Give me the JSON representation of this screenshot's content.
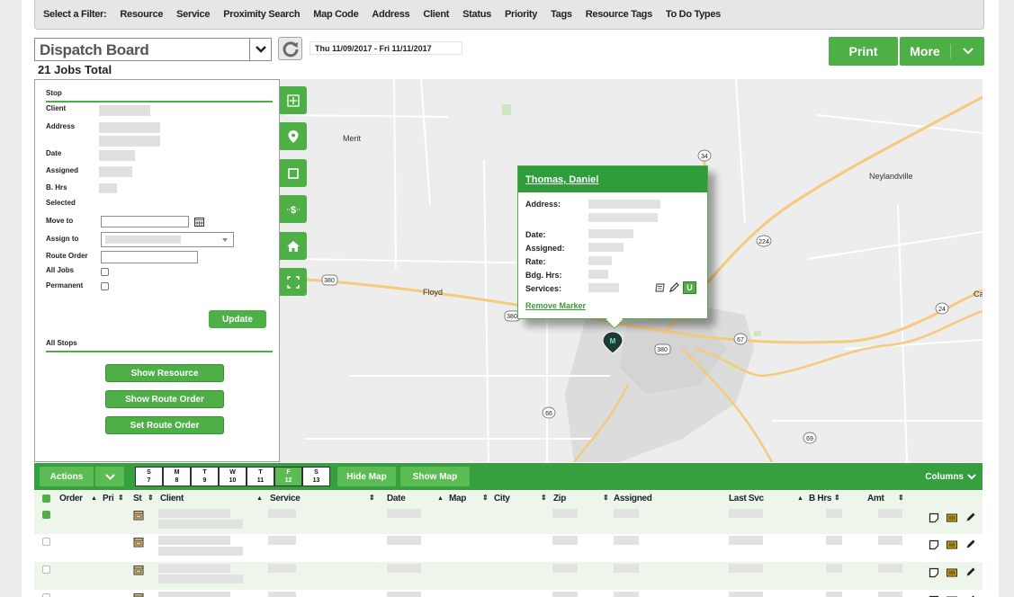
{
  "filter_bar": {
    "label": "Select a Filter:",
    "items": [
      "Resource",
      "Service",
      "Proximity Search",
      "Map Code",
      "Address",
      "Client",
      "Status",
      "Priority",
      "Tags",
      "Resource Tags",
      "To Do Types"
    ]
  },
  "header": {
    "board_name": "Dispatch Board",
    "date_range": "Thu 11/09/2017 - Fri 11/11/2017",
    "jobs_total": "21 Jobs Total",
    "print_label": "Print",
    "more_label": "More"
  },
  "side_panel": {
    "stop_heading": "Stop",
    "client_label": "Client",
    "address_label": "Address",
    "date_label": "Date",
    "assigned_label": "Assigned",
    "bhrs_label": "B. Hrs",
    "selected_label": "Selected",
    "move_to_label": "Move to",
    "assign_to_label": "Assign to",
    "route_order_label": "Route Order",
    "all_jobs_label": "All Jobs",
    "permanent_label": "Permanent",
    "update_label": "Update",
    "all_stops_heading": "All Stops",
    "show_resource_label": "Show Resource",
    "show_route_order_label": "Show Route Order",
    "set_route_order_label": "Set Route Order"
  },
  "map_tools": [
    "move-icon",
    "pin-icon",
    "square-select-icon",
    "dollar-icon",
    "home-icon",
    "fullscreen-icon"
  ],
  "map": {
    "places": {
      "merit": "Merit",
      "neylandville": "Neylandville",
      "floyd": "Floyd",
      "ca": "Ca"
    },
    "shields": {
      "s34": "34",
      "s224": "224",
      "s380a": "380",
      "s380b": "380",
      "s380c": "380",
      "s67": "67",
      "s66": "66",
      "s69": "69",
      "s24": "24"
    },
    "marker_label": "M"
  },
  "popup": {
    "title": "Thomas, Daniel",
    "address_label": "Address:",
    "date_label": "Date:",
    "assigned_label": "Assigned:",
    "rate_label": "Rate:",
    "bdg_hrs_label": "Bdg. Hrs:",
    "services_label": "Services:",
    "u_badge": "U",
    "remove_marker": "Remove Marker"
  },
  "toolbar": {
    "actions_label": "Actions",
    "days": [
      {
        "d": "S",
        "n": "7"
      },
      {
        "d": "M",
        "n": "8"
      },
      {
        "d": "T",
        "n": "9"
      },
      {
        "d": "W",
        "n": "10"
      },
      {
        "d": "T",
        "n": "11"
      },
      {
        "d": "F",
        "n": "12"
      },
      {
        "d": "S",
        "n": "13"
      }
    ],
    "selected_day": "F",
    "hide_map_label": "Hide Map",
    "show_map_label": "Show Map",
    "columns_label": "Columns"
  },
  "table": {
    "columns": {
      "order": "Order",
      "pri": "Pri",
      "st": "St",
      "client": "Client",
      "service": "Service",
      "date": "Date",
      "map": "Map",
      "city": "City",
      "zip": "Zip",
      "assigned": "Assigned",
      "last_svc": "Last Svc",
      "bhrs": "B Hrs",
      "amt": "Amt"
    },
    "rows": [
      {
        "checked": true
      },
      {
        "checked": false
      },
      {
        "checked": false
      },
      {
        "checked": false
      }
    ]
  },
  "colors": {
    "brand_green": "#4eaf47",
    "toolbar_green": "#36a03f",
    "popup_header_green": "#2f9e3a"
  }
}
